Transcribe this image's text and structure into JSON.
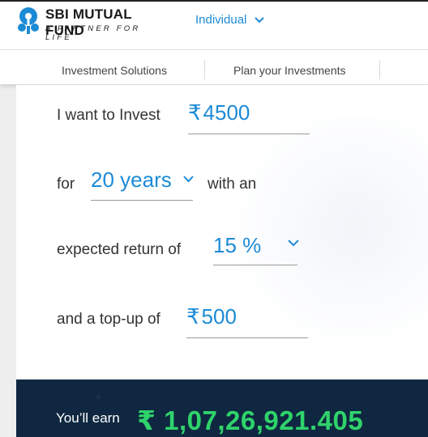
{
  "brand": {
    "name": "SBI MUTUAL FUND",
    "tagline": "A PARTNER FOR LIFE",
    "color": "#1c8bd6"
  },
  "header": {
    "segment_label": "Individual"
  },
  "nav": {
    "items": [
      {
        "label": "Investment Solutions"
      },
      {
        "label": "Plan your Investments"
      }
    ]
  },
  "calculator": {
    "invest_label": "I want to Invest",
    "invest_value": "4500",
    "for_label": "for",
    "years_value": "20 years",
    "with_label": "with an",
    "return_label": "expected return of",
    "return_value": "15 %",
    "topup_label": "and a top-up of",
    "topup_value": "500",
    "currency_symbol": "₹"
  },
  "result": {
    "label": "You’ll earn",
    "value": "₹ 1,07,26,921.405",
    "value_color": "#2fd36b",
    "background": "#0f2740"
  },
  "icons": {
    "logo": "sbi-keyhole-logo-icon",
    "dropdown": "chevron-down-icon"
  }
}
